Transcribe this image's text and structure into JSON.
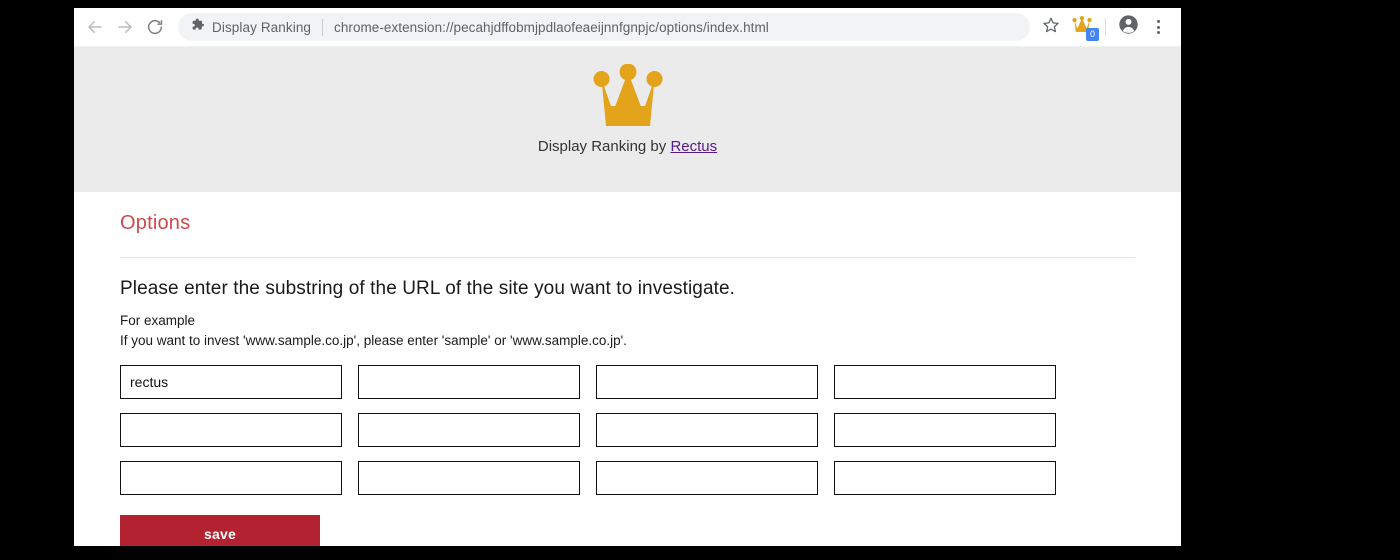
{
  "browser": {
    "nav": {
      "back_label": "Back",
      "forward_label": "Forward",
      "reload_label": "Reload"
    },
    "omnibox": {
      "extension_icon": "puzzle-piece-icon",
      "extension_title": "Display Ranking",
      "url": "chrome-extension://pecahjdffobmjpdlaofeaeijnnfgnpjc/options/index.html"
    },
    "actions": {
      "bookmark_icon": "star-icon",
      "extension_icon": "crown-icon",
      "extension_badge": "0",
      "profile_icon": "account-avatar-icon",
      "menu_icon": "three-dot-menu-icon"
    },
    "colors": {
      "badge_blue": "#4285f4",
      "omnibox_bg": "#f1f3f4"
    }
  },
  "page": {
    "header": {
      "logo_icon": "crown-icon",
      "logo_color": "#e3a41c",
      "brand_prefix": "Display Ranking by ",
      "brand_link": "Rectus",
      "brand_link_color": "#551a8b",
      "background": "#ebebeb"
    },
    "title": "Options",
    "title_color": "#cf4a4a",
    "lead": "Please enter the substring of the URL of the site you want to investigate.",
    "example_heading": "For example",
    "example_body": "If you want to invest 'www.sample.co.jp', please enter 'sample' or 'www.sample.co.jp'.",
    "fields": [
      {
        "value": "rectus",
        "placeholder": ""
      },
      {
        "value": "",
        "placeholder": ""
      },
      {
        "value": "",
        "placeholder": ""
      },
      {
        "value": "",
        "placeholder": ""
      },
      {
        "value": "",
        "placeholder": ""
      },
      {
        "value": "",
        "placeholder": ""
      },
      {
        "value": "",
        "placeholder": ""
      },
      {
        "value": "",
        "placeholder": ""
      },
      {
        "value": "",
        "placeholder": ""
      },
      {
        "value": "",
        "placeholder": ""
      },
      {
        "value": "",
        "placeholder": ""
      },
      {
        "value": "",
        "placeholder": ""
      }
    ],
    "save_label": "save",
    "save_color": "#b22230"
  }
}
